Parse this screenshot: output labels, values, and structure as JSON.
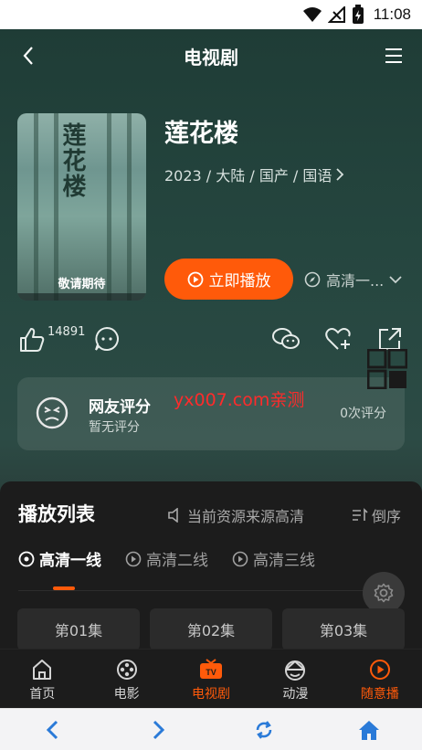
{
  "status_bar": {
    "time": "11:08"
  },
  "header": {
    "title": "电视剧"
  },
  "show": {
    "title": "莲花楼",
    "meta": "2023 / 大陆 / 国产 / 国语",
    "poster_title": "莲花楼",
    "poster_caption": "敬请期待"
  },
  "actions": {
    "play_label": "立即播放",
    "source_label": "高清一...",
    "like_count": "14891"
  },
  "rating": {
    "label": "网友评分",
    "sub": "暂无评分",
    "count": "0次评分"
  },
  "watermark": "yx007.com亲测",
  "playlist": {
    "title": "播放列表",
    "source_note": "当前资源来源高清",
    "sort_label": "倒序",
    "lines": [
      "高清一线",
      "高清二线",
      "高清三线"
    ],
    "episodes": [
      "第01集",
      "第02集",
      "第03集"
    ]
  },
  "tabbar": {
    "items": [
      {
        "label": "首页",
        "icon": "home-icon"
      },
      {
        "label": "电影",
        "icon": "film-reel-icon"
      },
      {
        "label": "电视剧",
        "icon": "tv-icon"
      },
      {
        "label": "动漫",
        "icon": "anime-icon"
      },
      {
        "label": "随意播",
        "icon": "play-circle-icon"
      }
    ],
    "active_index": 2
  },
  "browser_bar": {
    "icons": [
      "back-arrow-icon",
      "forward-arrow-icon",
      "refresh-icon",
      "home-icon"
    ]
  },
  "colors": {
    "accent": "#ff5a0a",
    "background": "#25463f",
    "panel": "#1c1c1c"
  }
}
